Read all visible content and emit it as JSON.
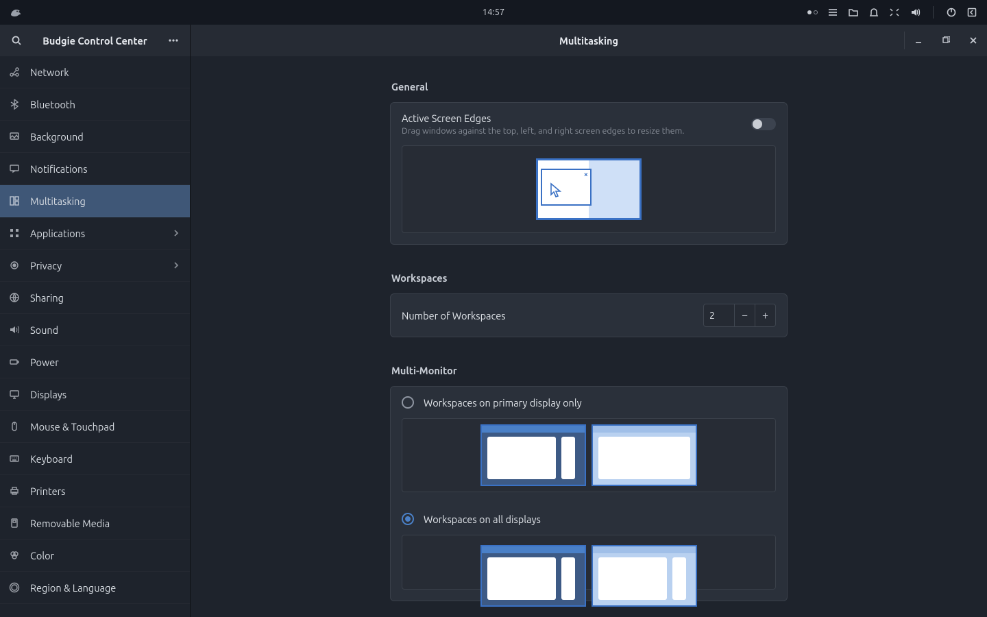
{
  "panel": {
    "clock": "14:57"
  },
  "app": {
    "sidebar_title": "Budgie Control Center",
    "main_title": "Multitasking",
    "sidebar": [
      {
        "label": "Network",
        "icon": "network"
      },
      {
        "label": "Bluetooth",
        "icon": "bluetooth"
      },
      {
        "label": "Background",
        "icon": "background"
      },
      {
        "label": "Notifications",
        "icon": "notifications"
      },
      {
        "label": "Multitasking",
        "icon": "multitasking",
        "active": true
      },
      {
        "label": "Applications",
        "icon": "applications",
        "chevron": true
      },
      {
        "label": "Privacy",
        "icon": "privacy",
        "chevron": true
      },
      {
        "label": "Sharing",
        "icon": "sharing"
      },
      {
        "label": "Sound",
        "icon": "sound"
      },
      {
        "label": "Power",
        "icon": "power"
      },
      {
        "label": "Displays",
        "icon": "displays"
      },
      {
        "label": "Mouse & Touchpad",
        "icon": "mouse"
      },
      {
        "label": "Keyboard",
        "icon": "keyboard"
      },
      {
        "label": "Printers",
        "icon": "printers"
      },
      {
        "label": "Removable Media",
        "icon": "media"
      },
      {
        "label": "Color",
        "icon": "color"
      },
      {
        "label": "Region & Language",
        "icon": "region"
      }
    ]
  },
  "general": {
    "heading": "General",
    "active_edges_title": "Active Screen Edges",
    "active_edges_sub": "Drag windows against the top, left, and right screen edges to resize them.",
    "active_edges_on": false
  },
  "workspaces": {
    "heading": "Workspaces",
    "count_label": "Number of Workspaces",
    "count": "2"
  },
  "multimonitor": {
    "heading": "Multi-Monitor",
    "primary_only_label": "Workspaces on primary display only",
    "all_displays_label": "Workspaces on all displays",
    "selected": "all"
  }
}
